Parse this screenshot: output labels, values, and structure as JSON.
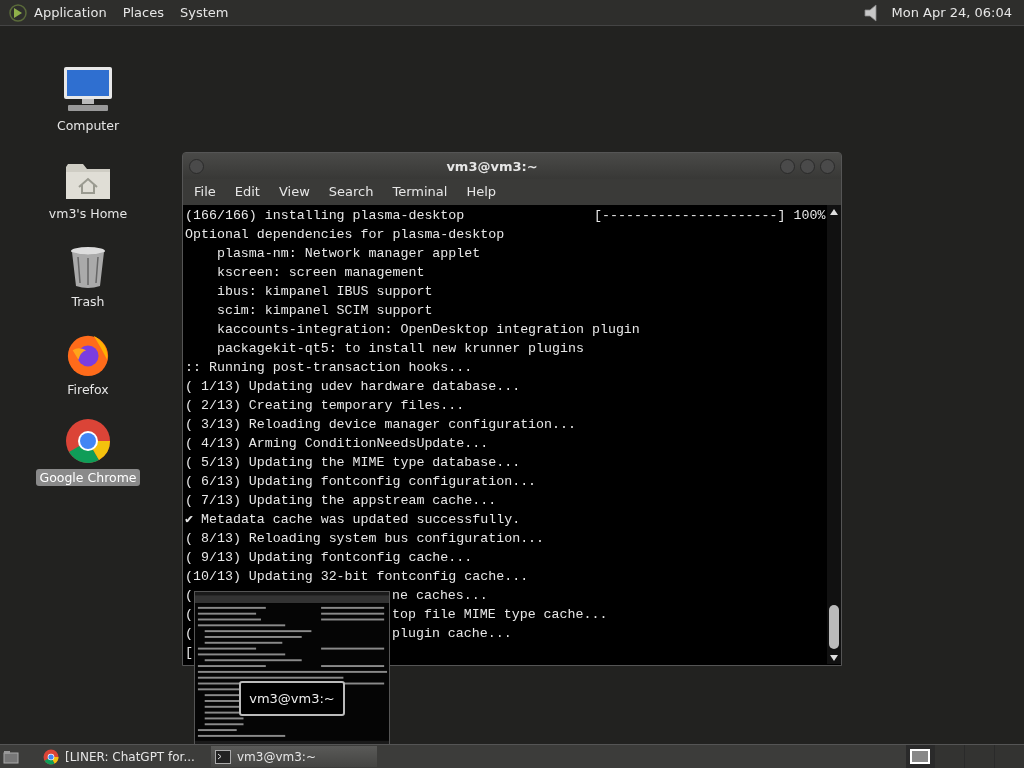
{
  "top_panel": {
    "menus": [
      {
        "label": "Application"
      },
      {
        "label": "Places"
      },
      {
        "label": "System"
      }
    ],
    "clock": "Mon Apr 24, 06:04"
  },
  "desktop_icons": [
    {
      "label": "Computer",
      "kind": "computer",
      "selected": false
    },
    {
      "label": "vm3's Home",
      "kind": "home",
      "selected": false
    },
    {
      "label": "Trash",
      "kind": "trash",
      "selected": false
    },
    {
      "label": "Firefox",
      "kind": "firefox",
      "selected": false
    },
    {
      "label": "Google Chrome",
      "kind": "chrome",
      "selected": true
    }
  ],
  "terminal": {
    "title": "vm3@vm3:~",
    "menu": [
      "File",
      "Edit",
      "View",
      "Search",
      "Terminal",
      "Help"
    ],
    "lines": [
      {
        "text": "(166/166) installing plasma-desktop",
        "progress": "[----------------------] 100%"
      },
      {
        "text": "Optional dependencies for plasma-desktop"
      },
      {
        "text": "    plasma-nm: Network manager applet"
      },
      {
        "text": "    kscreen: screen management"
      },
      {
        "text": "    ibus: kimpanel IBUS support"
      },
      {
        "text": "    scim: kimpanel SCIM support"
      },
      {
        "text": "    kaccounts-integration: OpenDesktop integration plugin"
      },
      {
        "text": "    packagekit-qt5: to install new krunner plugins"
      },
      {
        "text": ":: Running post-transaction hooks..."
      },
      {
        "text": "( 1/13) Updating udev hardware database..."
      },
      {
        "text": "( 2/13) Creating temporary files..."
      },
      {
        "text": "( 3/13) Reloading device manager configuration..."
      },
      {
        "text": "( 4/13) Arming ConditionNeedsUpdate..."
      },
      {
        "text": "( 5/13) Updating the MIME type database..."
      },
      {
        "text": "( 6/13) Updating fontconfig configuration..."
      },
      {
        "text": "( 7/13) Updating the appstream cache..."
      },
      {
        "text": "✔ Metadata cache was updated successfully."
      },
      {
        "text": "( 8/13) Reloading system bus configuration..."
      },
      {
        "text": "( 9/13) Updating fontconfig cache..."
      },
      {
        "text": "(10/13) Updating 32-bit fontconfig cache..."
      },
      {
        "text": "(",
        "after_overlay": "ne caches..."
      },
      {
        "text": "(",
        "after_overlay": "top file MIME type cache..."
      },
      {
        "text": "(",
        "after_overlay": "plugin cache..."
      },
      {
        "text": "["
      }
    ]
  },
  "window_preview": {
    "label": "vm3@vm3:~"
  },
  "taskbar": {
    "tasks": [
      {
        "label": "[LINER: ChatGPT for...",
        "kind": "browser",
        "selected": false
      },
      {
        "label": "vm3@vm3:~",
        "kind": "terminal",
        "selected": true
      }
    ],
    "workspaces": [
      {
        "selected": true
      },
      {
        "selected": false
      },
      {
        "selected": false
      },
      {
        "selected": false
      }
    ]
  }
}
